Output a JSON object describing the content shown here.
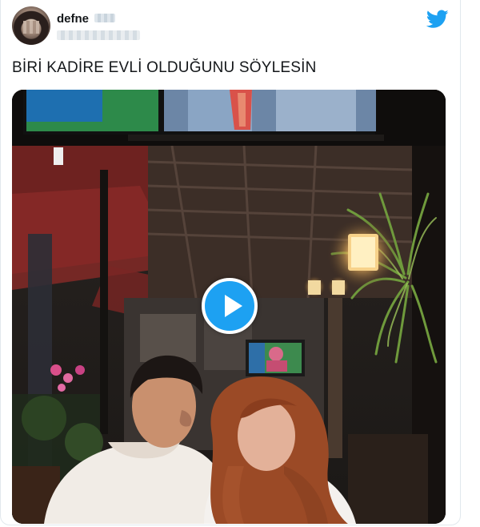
{
  "tweet": {
    "author_name": "defne",
    "text": "BİRİ KADİRE EVLİ OLDUĞUNU SÖYLESİN"
  },
  "icons": {
    "brand": "twitter-bird-icon",
    "media_action": "play-icon"
  },
  "colors": {
    "twitter_blue": "#1da1f2",
    "text": "#14171a",
    "border": "#e1e8ed"
  }
}
